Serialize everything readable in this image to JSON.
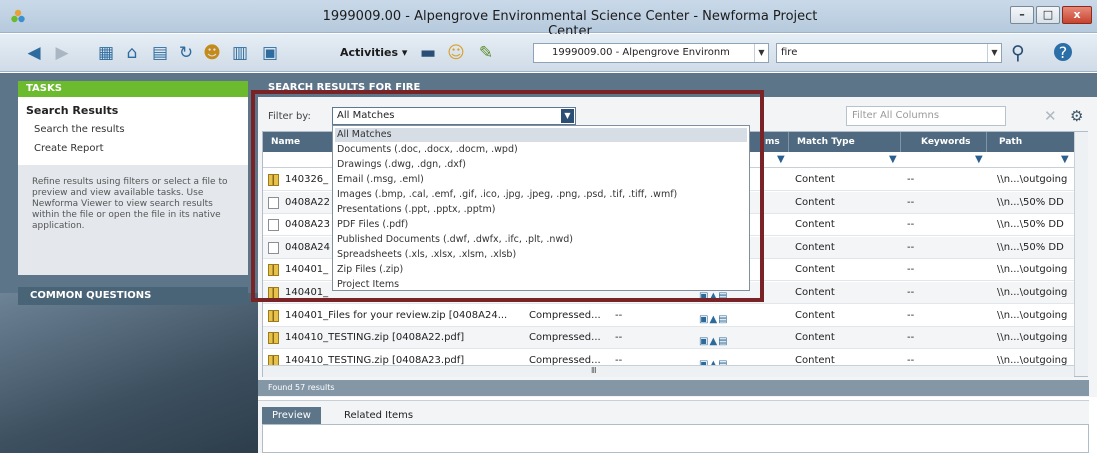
{
  "window": {
    "title": "1999009.00 - Alpengrove Environmental Science Center - Newforma Project Center",
    "controls": {
      "minimize": "–",
      "maximize": "□",
      "close": "x"
    }
  },
  "toolbar": {
    "activities_label": "Activities",
    "project_combo_value": "1999009.00 - Alpengrove Environm",
    "search_value": "fire",
    "icons": [
      "back-arrow",
      "forward-arrow",
      "project-icon",
      "home-icon",
      "calendar-icon",
      "refresh-icon",
      "people-icon",
      "panels-icon",
      "save-icon",
      "folder-icon",
      "contacts-icon",
      "pin-icon",
      "search-icon",
      "help-icon"
    ]
  },
  "left": {
    "tasks_header": "TASKS",
    "task_title": "Search Results",
    "task_links": [
      "Search the results",
      "Create Report"
    ],
    "help_text": "Refine results using filters or select a file to preview and view available tasks. Use Newforma Viewer to view search results within the file or open the file in its native application.",
    "common_questions": "COMMON QUESTIONS"
  },
  "main": {
    "header": "SEARCH RESULTS FOR FIRE",
    "filter_label": "Filter by:",
    "filter_value": "All Matches",
    "filter_all_placeholder": "Filter All Columns",
    "columns": [
      "Name",
      "ms",
      "Match Type",
      "Keywords",
      "Path"
    ],
    "rows": [
      {
        "name": "140326_",
        "type": "",
        "cat": "",
        "match": "Content",
        "kw": "--",
        "path": "\\\\n...\\outgoing",
        "icon": "zip"
      },
      {
        "name": "0408A22",
        "type": "",
        "cat": "",
        "match": "Content",
        "kw": "--",
        "path": "\\\\n...\\50% DD",
        "icon": "pdf"
      },
      {
        "name": "0408A23",
        "type": "",
        "cat": "",
        "match": "Content",
        "kw": "--",
        "path": "\\\\n...\\50% DD",
        "icon": "pdf"
      },
      {
        "name": "0408A24",
        "type": "",
        "cat": "",
        "match": "Content",
        "kw": "--",
        "path": "\\\\n...\\50% DD",
        "icon": "pdf"
      },
      {
        "name": "140401_",
        "type": "",
        "cat": "",
        "match": "Content",
        "kw": "--",
        "path": "\\\\n...\\outgoing",
        "icon": "zip"
      },
      {
        "name": "140401_",
        "type": "",
        "cat": "",
        "match": "Content",
        "kw": "--",
        "path": "\\\\n...\\outgoing",
        "icon": "zip"
      },
      {
        "name": "140401_Files for your review.zip [0408A24...",
        "type": "Compressed...",
        "cat": "--",
        "match": "Content",
        "kw": "--",
        "path": "\\\\n...\\outgoing",
        "icon": "zip"
      },
      {
        "name": "140410_TESTING.zip [0408A22.pdf]",
        "type": "Compressed...",
        "cat": "--",
        "match": "Content",
        "kw": "--",
        "path": "\\\\n...\\outgoing",
        "icon": "zip"
      },
      {
        "name": "140410_TESTING.zip [0408A23.pdf]",
        "type": "Compressed...",
        "cat": "--",
        "match": "Content",
        "kw": "--",
        "path": "\\\\n...\\outgoing",
        "icon": "zip"
      }
    ],
    "found_text": "Found 57 results",
    "tabs": [
      "Preview",
      "Related Items"
    ]
  },
  "dropdown": {
    "items": [
      "All Matches",
      "Documents (.doc, .docx, .docm, .wpd)",
      "Drawings (.dwg, .dgn, .dxf)",
      "Email (.msg, .eml)",
      "Images (.bmp, .cal, .emf, .gif, .ico, .jpg, .jpeg, .png, .psd, .tif, .tiff, .wmf)",
      "Presentations (.ppt, .pptx, .pptm)",
      "PDF Files (.pdf)",
      "Published Documents (.dwf, .dwfx, .ifc, .plt, .nwd)",
      "Spreadsheets (.xls, .xlsx, .xlsm, .xlsb)",
      "Zip Files (.zip)",
      "Project Items"
    ],
    "selected_index": 0
  },
  "colors": {
    "accent_green": "#6cba2d",
    "panel_blue": "#5d7589",
    "highlight_red": "#7a2326"
  }
}
